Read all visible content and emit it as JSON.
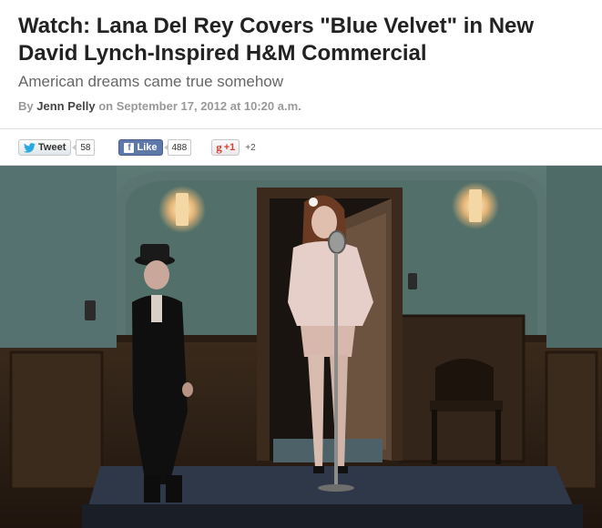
{
  "article": {
    "title": "Watch: Lana Del Rey Covers \"Blue Velvet\" in New David Lynch-Inspired H&M Commercial",
    "subtitle": "American dreams came true somehow",
    "byline": {
      "prefix": "By",
      "author": "Jenn Pelly",
      "on": "on",
      "date": "September 17, 2012 at 10:20 a.m."
    }
  },
  "share": {
    "tweet": {
      "label": "Tweet",
      "count": "58",
      "icon": "twitter-bird-icon"
    },
    "like": {
      "label": "Like",
      "count": "488",
      "icon": "facebook-f-icon"
    },
    "gplus": {
      "label": "+1",
      "count": "+2",
      "icon": "google-g-icon"
    }
  },
  "colors": {
    "title": "#222222",
    "subtitle": "#666666",
    "byline": "#999999",
    "twitter": "#2aa9e0",
    "facebook": "#5f78ab",
    "gplus": "#d73d32",
    "wall": "#56716d"
  }
}
